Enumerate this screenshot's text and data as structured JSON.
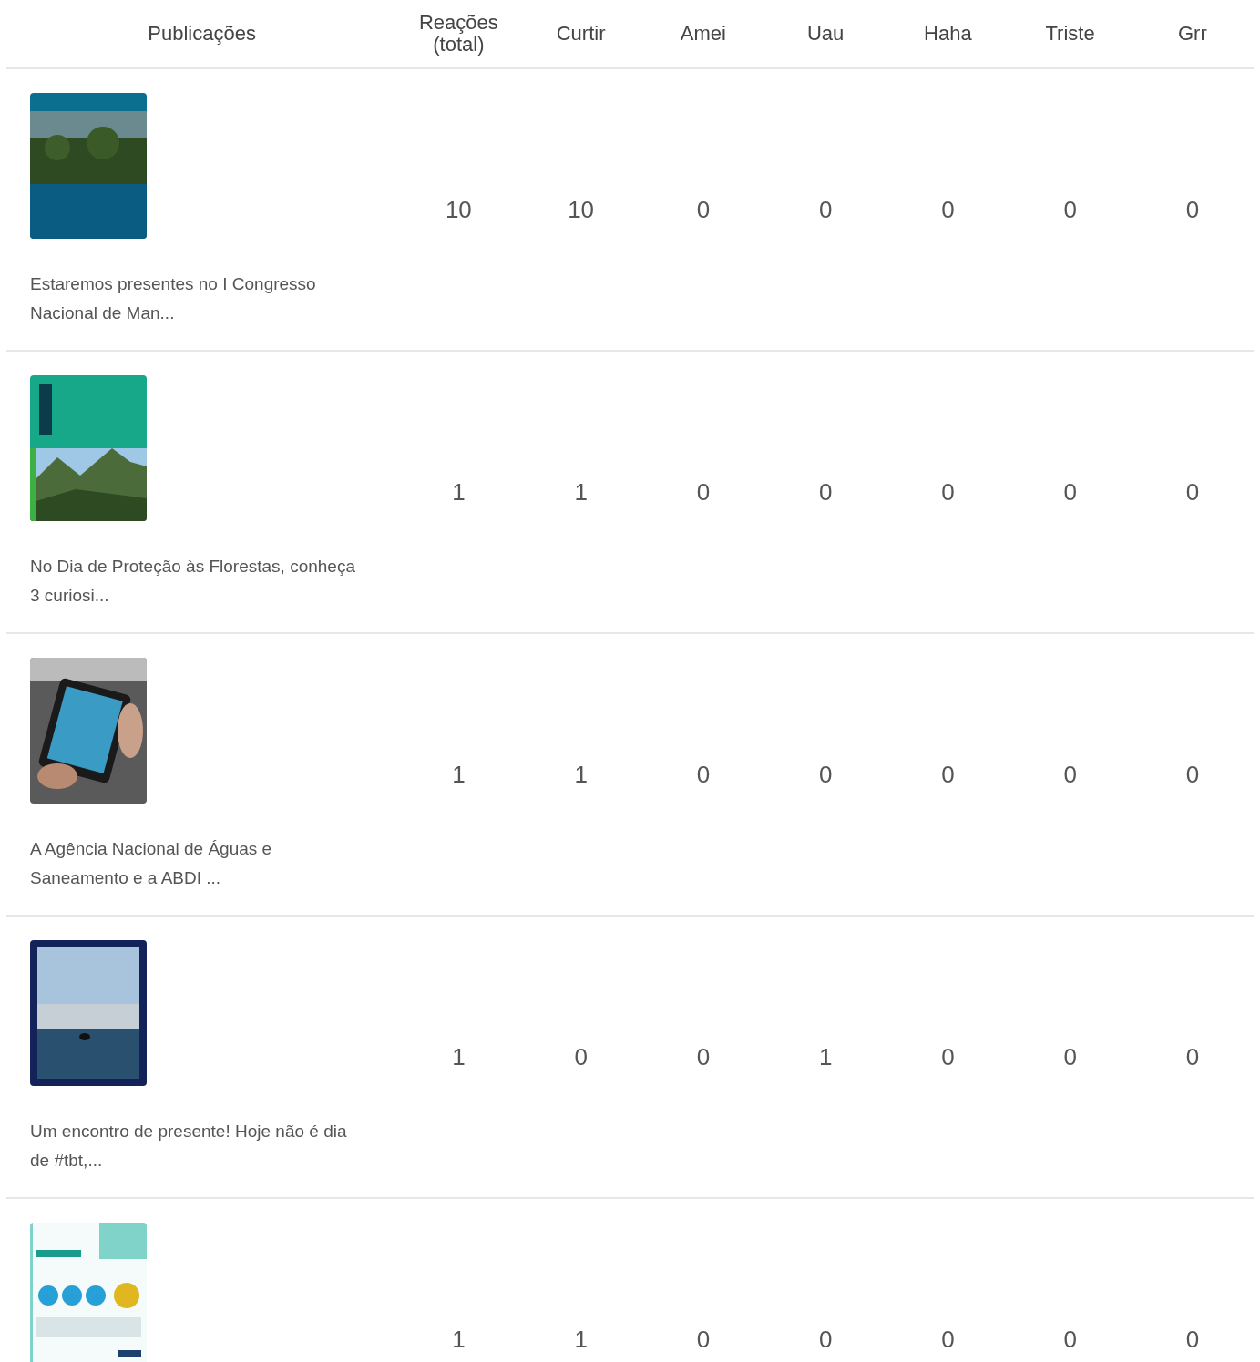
{
  "table": {
    "columns": [
      "Publicações",
      "Reações\n(total)",
      "Curtir",
      "Amei",
      "Uau",
      "Haha",
      "Triste",
      "Grr"
    ],
    "rows": [
      {
        "image": {
          "kind": "picture"
        },
        "caption": "Estaremos presentes no I Congresso Nacional de Man...",
        "values": [
          "10",
          "10",
          "0",
          "0",
          "0",
          "0",
          "0"
        ]
      },
      {
        "image": {
          "kind": "picture"
        },
        "caption": "No Dia de Proteção às Florestas, conheça 3 curiosi...",
        "values": [
          "1",
          "1",
          "0",
          "0",
          "0",
          "0",
          "0"
        ]
      },
      {
        "image": {
          "kind": "picture"
        },
        "caption": "A Agência Nacional de Águas e Saneamento e a ABDI ...",
        "values": [
          "1",
          "1",
          "0",
          "0",
          "0",
          "0",
          "0"
        ]
      },
      {
        "image": {
          "kind": "picture"
        },
        "caption": "Um encontro de presente! Hoje não é dia de #tbt,...",
        "values": [
          "1",
          "0",
          "0",
          "1",
          "0",
          "0",
          "0"
        ]
      },
      {
        "image": {
          "kind": "picture"
        },
        "values": [
          "1",
          "1",
          "0",
          "0",
          "0",
          "0",
          "0"
        ]
      }
    ]
  }
}
